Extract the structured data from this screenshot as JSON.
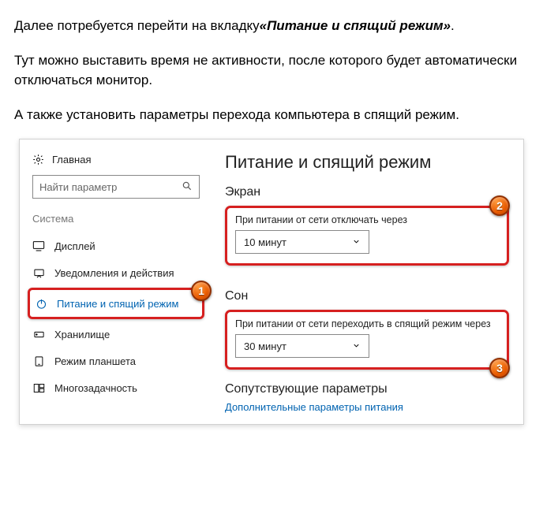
{
  "article": {
    "p1_a": "Далее потребуется перейти на вкладку",
    "p1_b": "«Питание и спящий режим»",
    "p1_c": ".",
    "p2": "Тут можно выставить время не активности, после которого будет автоматически отключаться монитор.",
    "p3": "А также установить параметры перехода компьютера в спящий режим."
  },
  "sidebar": {
    "home": "Главная",
    "search_placeholder": "Найти параметр",
    "section_label": "Система",
    "items": {
      "display": "Дисплей",
      "notifications": "Уведомления и действия",
      "power": "Питание и спящий режим",
      "storage": "Хранилище",
      "tablet": "Режим планшета",
      "multitask": "Многозадачность"
    }
  },
  "content": {
    "title": "Питание и спящий режим",
    "screen_title": "Экран",
    "screen_label": "При питании от сети отключать через",
    "screen_value": "10 минут",
    "sleep_title": "Сон",
    "sleep_label": "При питании от сети переходить в спящий режим через",
    "sleep_value": "30 минут",
    "related_title": "Сопутствующие параметры",
    "related_link": "Дополнительные параметры питания"
  },
  "callouts": {
    "one": "1",
    "two": "2",
    "three": "3"
  }
}
